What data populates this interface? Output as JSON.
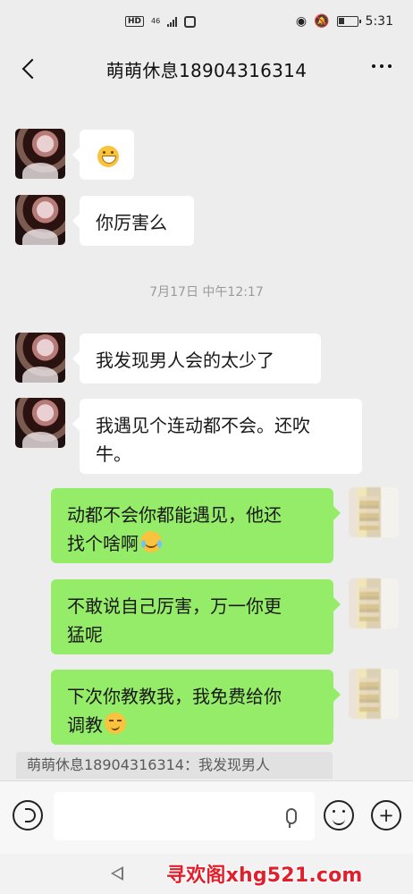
{
  "status_bar": {
    "hd": "HD",
    "network": "46",
    "time": "5:31"
  },
  "header": {
    "title": "萌萌休息18904316314"
  },
  "timestamp": "7月17日 中午12:17",
  "messages": [
    {
      "sender": "other",
      "text": "",
      "emoji": "grin-emoji"
    },
    {
      "sender": "other",
      "text": "你厉害么"
    },
    {
      "sender": "other",
      "text": "我发现男人会的太少了"
    },
    {
      "sender": "other",
      "line1": "我遇见个连动都不会。还吹",
      "line2": "牛。"
    },
    {
      "sender": "self",
      "line1": "动都不会你都能遇见，他还",
      "line2": "找个啥啊",
      "emoji": "laugh-cry-emoji"
    },
    {
      "sender": "self",
      "line1": "不敢说自己厉害，万一你更",
      "line2": "猛呢"
    },
    {
      "sender": "self",
      "line1": "下次你教教我，我免费给你",
      "line2": "调教",
      "emoji": "smirk-emoji"
    }
  ],
  "quote": {
    "text": "萌萌休息18904316314：我发现男人"
  },
  "input": {
    "value": ""
  },
  "watermark": "寻欢阁xhg521.com",
  "colors": {
    "background": "#ededed",
    "self_bubble": "#95ec69",
    "other_bubble": "#ffffff",
    "watermark": "#e0202d"
  }
}
